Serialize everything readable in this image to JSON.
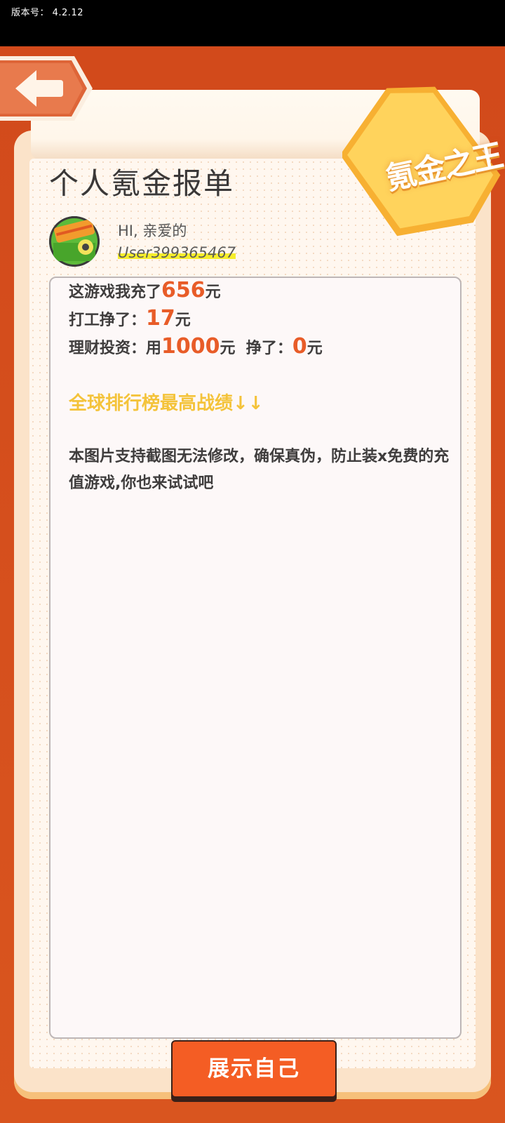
{
  "status_bar": {
    "version_label": "版本号： 4.2.12"
  },
  "header": {
    "back_icon": "back-arrow-icon",
    "badge_text": "氪金之王"
  },
  "report_page": {
    "title": "个人氪金报单",
    "greeting": "HI, 亲爱的",
    "username": "User399365467"
  },
  "stats": {
    "recharge_prefix": "这游戏我充了",
    "recharge_amount": "656",
    "recharge_unit": "元",
    "work_prefix": "打工挣了：",
    "work_amount": "17",
    "work_unit": "元",
    "invest_prefix": "理财投资：用",
    "invest_amount": "1000",
    "invest_mid": "元  挣了：",
    "invest_earned": "0",
    "invest_unit": "元"
  },
  "ranking_label": "全球排行榜最高战绩↓↓",
  "notice": "本图片支持截图无法修改，确保真伪，防止装x免费的充值游戏,你也来试试吧",
  "show_button_label": "展示自己",
  "colors": {
    "accent_orange": "#d5501e",
    "button_orange": "#f45d24",
    "number_orange": "#e85c28",
    "rank_yellow": "#f4c33a",
    "username_highlight": "#f6ee2b"
  }
}
